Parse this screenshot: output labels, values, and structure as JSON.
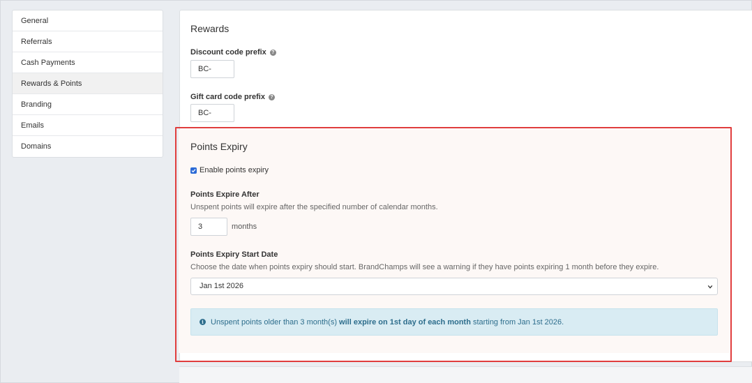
{
  "sidebar": {
    "items": [
      {
        "label": "General"
      },
      {
        "label": "Referrals"
      },
      {
        "label": "Cash Payments"
      },
      {
        "label": "Rewards & Points"
      },
      {
        "label": "Branding"
      },
      {
        "label": "Emails"
      },
      {
        "label": "Domains"
      }
    ]
  },
  "rewards": {
    "title": "Rewards",
    "discount_label": "Discount code prefix",
    "discount_value": "BC-",
    "giftcard_label": "Gift card code prefix",
    "giftcard_value": "BC-"
  },
  "expiry": {
    "title": "Points Expiry",
    "enable_label": "Enable points expiry",
    "enable_checked": true,
    "after_label": "Points Expire After",
    "after_help": "Unspent points will expire after the specified number of calendar months.",
    "months_value": "3",
    "months_unit": "months",
    "start_label": "Points Expiry Start Date",
    "start_help": "Choose the date when points expiry should start. BrandChamps will see a warning if they have points expiring 1 month before they expire.",
    "start_selected": "Jan 1st 2026",
    "alert_prefix": "Unspent points older than 3 month(s) ",
    "alert_bold": "will expire on 1st day of each month",
    "alert_suffix": " starting from Jan 1st 2026."
  },
  "colors": {
    "highlight": "#e03d3d",
    "checkbox": "#2b6ad6",
    "alert_bg": "#d9ecf3",
    "alert_text": "#2d6d8c"
  }
}
